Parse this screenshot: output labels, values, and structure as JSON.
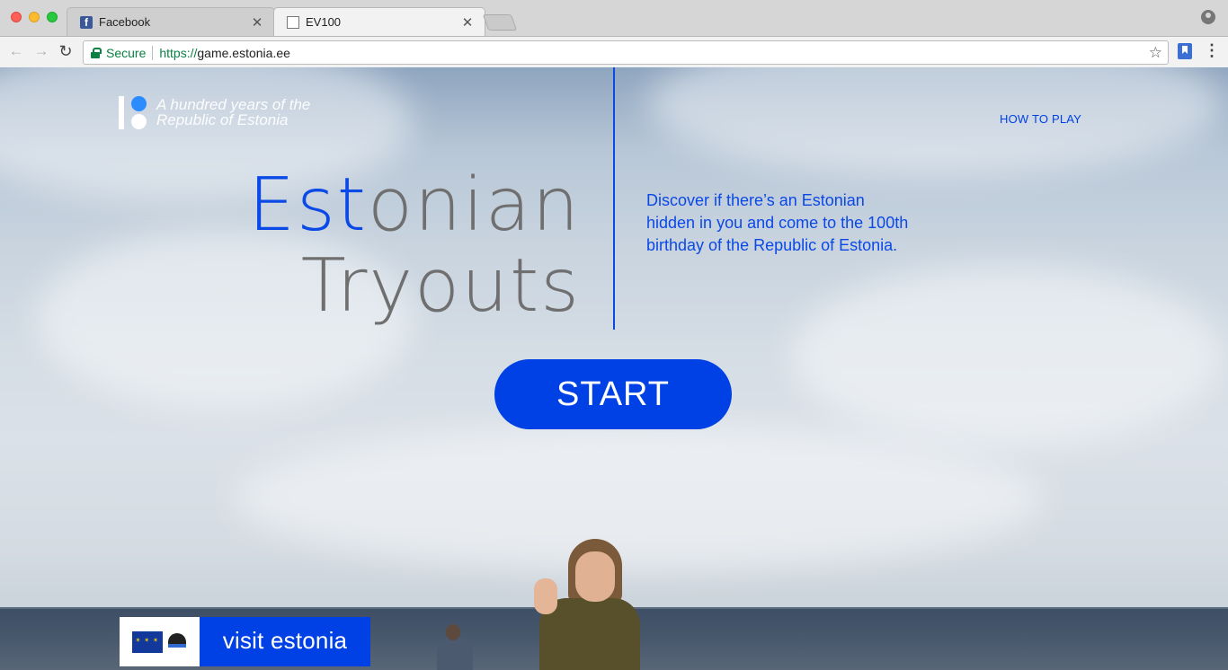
{
  "browser": {
    "tabs": [
      {
        "title": "Facebook",
        "icon": "facebook-icon"
      },
      {
        "title": "EV100",
        "icon": "page-icon"
      }
    ],
    "address": {
      "security_label": "Secure",
      "scheme": "https://",
      "host": "game.estonia.ee"
    }
  },
  "page": {
    "logo_text_line1": "A hundred years of the",
    "logo_text_line2": "Republic of Estonia",
    "nav_how_to_play": "HOW TO PLAY",
    "title_line1_accent": "Est",
    "title_line1_rest": "onian",
    "title_line2": "Tryouts",
    "lede": "Discover if there’s an Estonian hidden in you and come to the 100th birthday of the Republic of Estonia.",
    "start_label": "START",
    "visit_label": "visit estonia"
  },
  "colors": {
    "brand_blue": "#0041e6",
    "logo_blue": "#2b8cff",
    "title_gray": "#6f6f6f",
    "secure_green": "#0a8043"
  }
}
